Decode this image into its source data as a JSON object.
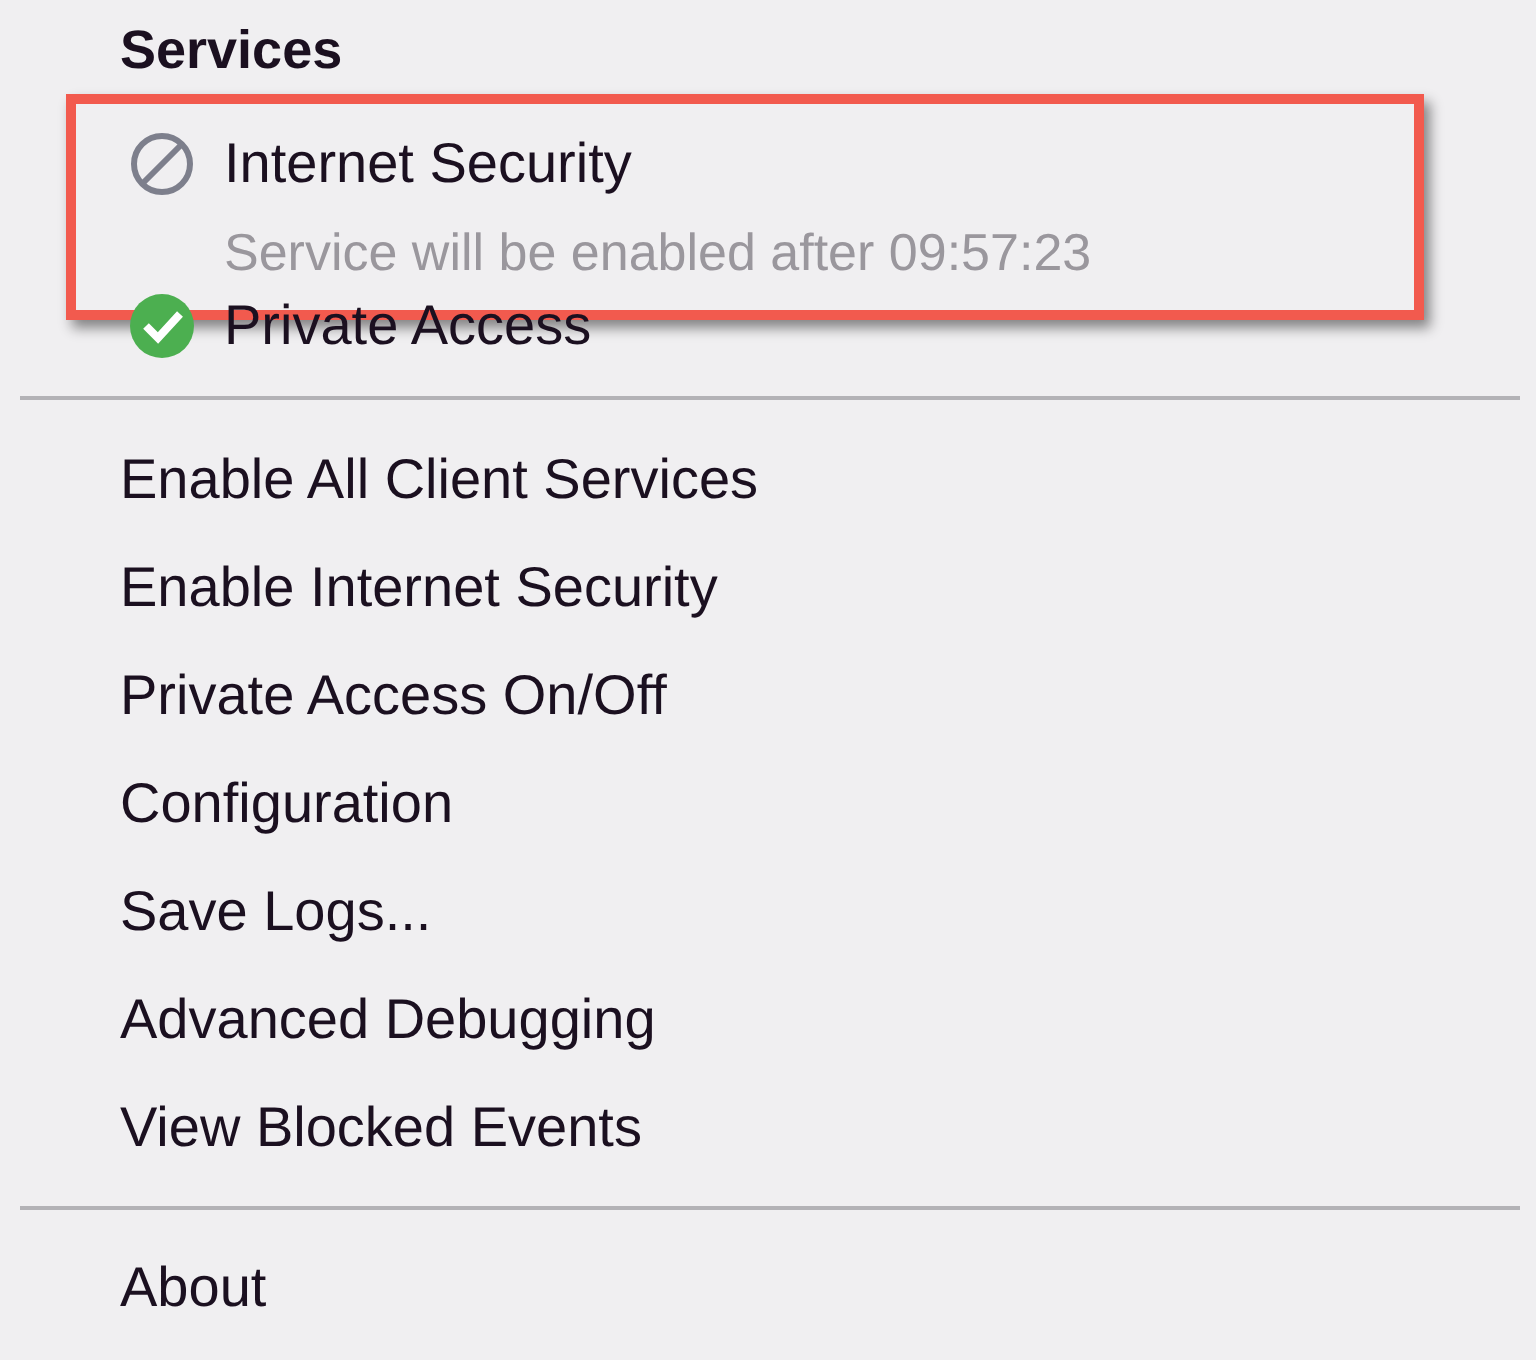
{
  "menu": {
    "heading": "Services",
    "services": [
      {
        "name": "Internet Security",
        "enabled": false,
        "note": "Service will be enabled after 09:57:23",
        "highlighted": true
      },
      {
        "name": "Private Access",
        "enabled": true,
        "highlighted": false
      }
    ],
    "actions": [
      "Enable All Client Services",
      "Enable Internet Security",
      "Private Access On/Off",
      "Configuration",
      "Save Logs...",
      "Advanced Debugging",
      "View Blocked Events"
    ],
    "footer": [
      "About"
    ]
  }
}
